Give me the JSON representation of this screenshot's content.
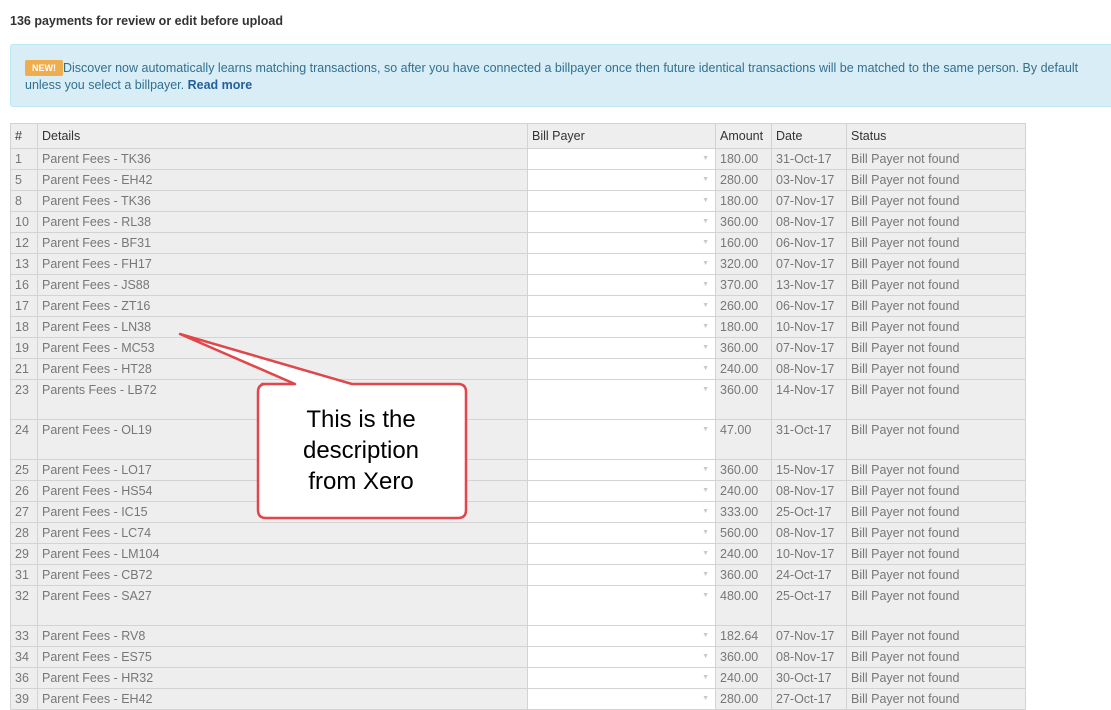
{
  "page_title": "136 payments for review or edit before upload",
  "notice": {
    "badge": "NEW!",
    "text_line1": "Discover now automatically learns matching transactions, so after you have connected a billpayer once then future identical transactions will be matched to the same person. By default",
    "text_line2": "unless you select a billpayer.",
    "read_more": "Read more"
  },
  "table": {
    "headers": {
      "num": "#",
      "details": "Details",
      "bill_payer": "Bill Payer",
      "amount": "Amount",
      "date": "Date",
      "status": "Status"
    },
    "rows": [
      {
        "num": "1",
        "details": "Parent Fees - TK36",
        "amount": "180.00",
        "date": "31-Oct-17",
        "status": "Bill Payer not found"
      },
      {
        "num": "5",
        "details": "Parent Fees - EH42",
        "amount": "280.00",
        "date": "03-Nov-17",
        "status": "Bill Payer not found"
      },
      {
        "num": "8",
        "details": "Parent Fees - TK36",
        "amount": "180.00",
        "date": "07-Nov-17",
        "status": "Bill Payer not found"
      },
      {
        "num": "10",
        "details": "Parent Fees - RL38",
        "amount": "360.00",
        "date": "08-Nov-17",
        "status": "Bill Payer not found"
      },
      {
        "num": "12",
        "details": "Parent Fees - BF31",
        "amount": "160.00",
        "date": "06-Nov-17",
        "status": "Bill Payer not found"
      },
      {
        "num": "13",
        "details": "Parent Fees - FH17",
        "amount": "320.00",
        "date": "07-Nov-17",
        "status": "Bill Payer not found"
      },
      {
        "num": "16",
        "details": "Parent Fees - JS88",
        "amount": "370.00",
        "date": "13-Nov-17",
        "status": "Bill Payer not found"
      },
      {
        "num": "17",
        "details": "Parent Fees - ZT16",
        "amount": "260.00",
        "date": "06-Nov-17",
        "status": "Bill Payer not found"
      },
      {
        "num": "18",
        "details": "Parent Fees - LN38",
        "amount": "180.00",
        "date": "10-Nov-17",
        "status": "Bill Payer not found"
      },
      {
        "num": "19",
        "details": "Parent Fees - MC53",
        "amount": "360.00",
        "date": "07-Nov-17",
        "status": "Bill Payer not found"
      },
      {
        "num": "21",
        "details": "Parent Fees - HT28",
        "amount": "240.00",
        "date": "08-Nov-17",
        "status": "Bill Payer not found"
      },
      {
        "num": "23",
        "details": "Parents Fees - LB72",
        "amount": "360.00",
        "date": "14-Nov-17",
        "status": "Bill Payer not found",
        "tall": true
      },
      {
        "num": "24",
        "details": "Parent Fees - OL19",
        "amount": "47.00",
        "date": "31-Oct-17",
        "status": "Bill Payer not found",
        "tall": true
      },
      {
        "num": "25",
        "details": "Parent Fees - LO17",
        "amount": "360.00",
        "date": "15-Nov-17",
        "status": "Bill Payer not found"
      },
      {
        "num": "26",
        "details": "Parent Fees - HS54",
        "amount": "240.00",
        "date": "08-Nov-17",
        "status": "Bill Payer not found"
      },
      {
        "num": "27",
        "details": "Parent Fees - IC15",
        "amount": "333.00",
        "date": "25-Oct-17",
        "status": "Bill Payer not found"
      },
      {
        "num": "28",
        "details": "Parent Fees - LC74",
        "amount": "560.00",
        "date": "08-Nov-17",
        "status": "Bill Payer not found"
      },
      {
        "num": "29",
        "details": "Parent Fees - LM104",
        "amount": "240.00",
        "date": "10-Nov-17",
        "status": "Bill Payer not found"
      },
      {
        "num": "31",
        "details": "Parent Fees - CB72",
        "amount": "360.00",
        "date": "24-Oct-17",
        "status": "Bill Payer not found"
      },
      {
        "num": "32",
        "details": "Parent Fees - SA27",
        "amount": "480.00",
        "date": "25-Oct-17",
        "status": "Bill Payer not found",
        "tall": true
      },
      {
        "num": "33",
        "details": "Parent Fees - RV8",
        "amount": "182.64",
        "date": "07-Nov-17",
        "status": "Bill Payer not found"
      },
      {
        "num": "34",
        "details": "Parent Fees - ES75",
        "amount": "360.00",
        "date": "08-Nov-17",
        "status": "Bill Payer not found"
      },
      {
        "num": "36",
        "details": "Parent Fees - HR32",
        "amount": "240.00",
        "date": "30-Oct-17",
        "status": "Bill Payer not found"
      },
      {
        "num": "39",
        "details": "Parent Fees - EH42",
        "amount": "280.00",
        "date": "27-Oct-17",
        "status": "Bill Payer not found"
      }
    ]
  },
  "callout": {
    "line1": "This is the",
    "line2": "description",
    "line3": "from Xero"
  },
  "colors": {
    "notice_bg": "#d9edf7",
    "badge": "#f0ad4e",
    "callout_border": "#e0464a"
  }
}
